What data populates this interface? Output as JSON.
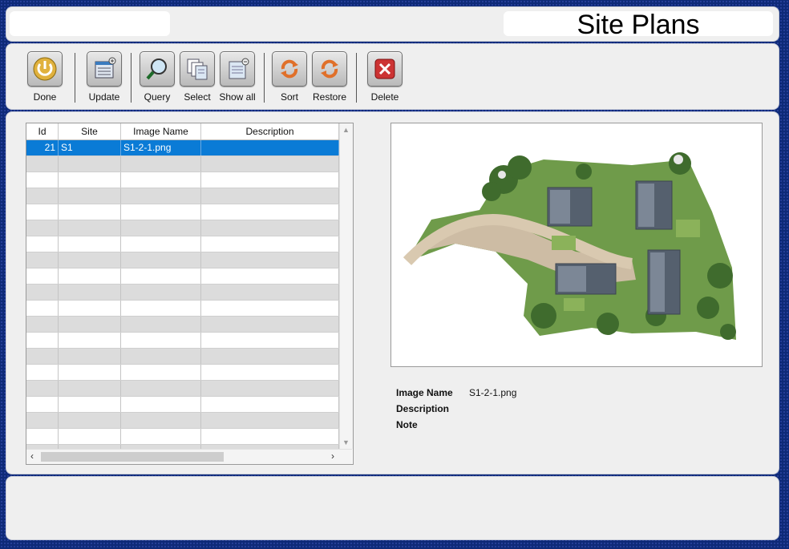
{
  "header": {
    "title": "Site Plans"
  },
  "toolbar": {
    "done": "Done",
    "update": "Update",
    "query": "Query",
    "select": "Select",
    "show_all": "Show all",
    "sort": "Sort",
    "restore": "Restore",
    "delete": "Delete"
  },
  "grid": {
    "columns": [
      "Id",
      "Site",
      "Image Name",
      "Description"
    ],
    "rows": [
      {
        "id": "21",
        "site": "S1",
        "image_name": "S1-2-1.png",
        "description": ""
      }
    ]
  },
  "details": {
    "image_name_label": "Image Name",
    "image_name_value": "S1-2-1.png",
    "description_label": "Description",
    "note_label": "Note"
  },
  "colors": {
    "frame": "#0e2a78",
    "panel": "#efefef",
    "selection": "#0a7bd6"
  }
}
